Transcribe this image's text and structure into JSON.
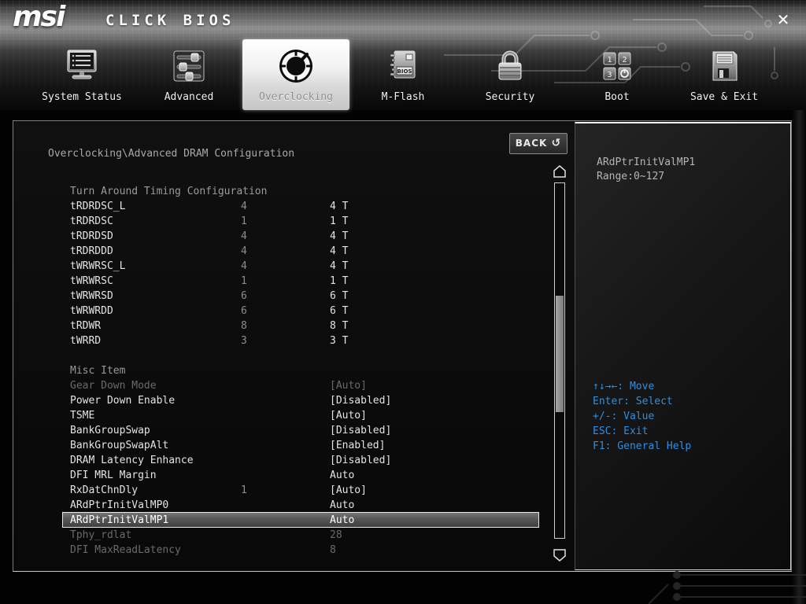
{
  "header": {
    "logo": "msi",
    "brand": "CLICK BIOS",
    "close_icon": "✕",
    "tabs": [
      {
        "label": "System Status",
        "icon": "system-status-icon",
        "selected": false
      },
      {
        "label": "Advanced",
        "icon": "advanced-icon",
        "selected": false
      },
      {
        "label": "Overclocking",
        "icon": "overclocking-icon",
        "selected": true
      },
      {
        "label": "M-Flash",
        "icon": "m-flash-icon",
        "selected": false
      },
      {
        "label": "Security",
        "icon": "security-icon",
        "selected": false
      },
      {
        "label": "Boot",
        "icon": "boot-icon",
        "selected": false
      },
      {
        "label": "Save & Exit",
        "icon": "save-exit-icon",
        "selected": false
      }
    ]
  },
  "main": {
    "breadcrumb": "Overclocking\\Advanced DRAM Configuration",
    "back_button": {
      "label": "BACK",
      "icon": "↺"
    },
    "rows": [
      {
        "label": "Turn Around Timing Configuration",
        "mid": "",
        "value": "",
        "state": "section"
      },
      {
        "label": "tRDRDSC_L",
        "mid": "4",
        "value": "4 T",
        "state": "normal"
      },
      {
        "label": "tRDRDSC",
        "mid": "1",
        "value": "1 T",
        "state": "normal"
      },
      {
        "label": "tRDRDSD",
        "mid": "4",
        "value": "4 T",
        "state": "normal"
      },
      {
        "label": "tRDRDDD",
        "mid": "4",
        "value": "4 T",
        "state": "normal"
      },
      {
        "label": "tWRWRSC_L",
        "mid": "4",
        "value": "4 T",
        "state": "normal"
      },
      {
        "label": "tWRWRSC",
        "mid": "1",
        "value": "1 T",
        "state": "normal"
      },
      {
        "label": "tWRWRSD",
        "mid": "6",
        "value": "6 T",
        "state": "normal"
      },
      {
        "label": "tWRWRDD",
        "mid": "6",
        "value": "6 T",
        "state": "normal"
      },
      {
        "label": "tRDWR",
        "mid": "8",
        "value": "8 T",
        "state": "normal"
      },
      {
        "label": "tWRRD",
        "mid": "3",
        "value": "3 T",
        "state": "normal"
      },
      {
        "label": "Misc Item",
        "mid": "",
        "value": "",
        "state": "section"
      },
      {
        "label": "Gear Down Mode",
        "mid": "",
        "value": "[Auto]",
        "state": "disabled"
      },
      {
        "label": "Power Down Enable",
        "mid": "",
        "value": "[Disabled]",
        "state": "normal"
      },
      {
        "label": "TSME",
        "mid": "",
        "value": "[Auto]",
        "state": "normal"
      },
      {
        "label": "BankGroupSwap",
        "mid": "",
        "value": "[Disabled]",
        "state": "normal"
      },
      {
        "label": "BankGroupSwapAlt",
        "mid": "",
        "value": "[Enabled]",
        "state": "normal"
      },
      {
        "label": "DRAM Latency Enhance",
        "mid": "",
        "value": "[Disabled]",
        "state": "normal"
      },
      {
        "label": "DFI MRL Margin",
        "mid": "",
        "value": "Auto",
        "state": "normal"
      },
      {
        "label": "RxDatChnDly",
        "mid": "1",
        "value": "[Auto]",
        "state": "normal"
      },
      {
        "label": "ARdPtrInitValMP0",
        "mid": "",
        "value": "Auto",
        "state": "normal"
      },
      {
        "label": "ARdPtrInitValMP1",
        "mid": "",
        "value": "Auto",
        "state": "selected"
      },
      {
        "label": "Tphy_rdlat",
        "mid": "",
        "value": "28",
        "state": "disabled"
      },
      {
        "label": "DFI MaxReadLatency",
        "mid": "",
        "value": "8",
        "state": "disabled"
      }
    ]
  },
  "help_panel": {
    "item_name": "ARdPtrInitValMP1",
    "range": "Range:0~127",
    "keys": [
      "↑↓→←: Move",
      "Enter: Select",
      "+/-: Value",
      "ESC: Exit",
      "F1: General Help"
    ]
  },
  "colors": {
    "help_key_blue": "#2f8fdf",
    "selected_tab_bg": "#f2f2f2",
    "normal_text": "#e4e4e4",
    "dim_text": "#6a6a6a",
    "section_text": "#9b9b9b"
  }
}
